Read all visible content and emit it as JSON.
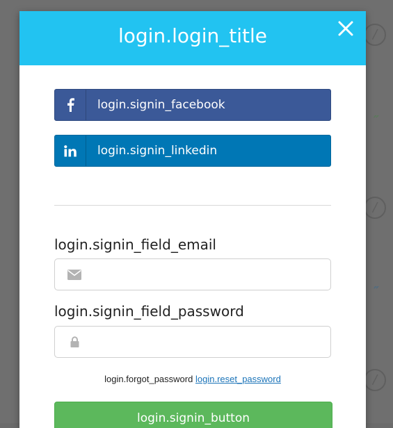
{
  "login": {
    "title": "login.login_title",
    "signin_facebook": "login.signin_facebook",
    "signin_linkedin": "login.signin_linkedin",
    "field_email_label": "login.signin_field_email",
    "field_password_label": "login.signin_field_password",
    "forgot_password": "login.forgot_password",
    "reset_password": "login.reset_password",
    "signin_button": "login.signin_button",
    "email_value": "",
    "password_value": ""
  },
  "icons": {
    "close": "close-icon",
    "facebook": "facebook-icon",
    "linkedin": "linkedin-icon",
    "email": "envelope-icon",
    "password": "lock-icon"
  },
  "colors": {
    "header": "#22c3f1",
    "facebook": "#3b5998",
    "linkedin": "#0077b5",
    "signin": "#5cb85c",
    "link": "#1a73b8"
  }
}
